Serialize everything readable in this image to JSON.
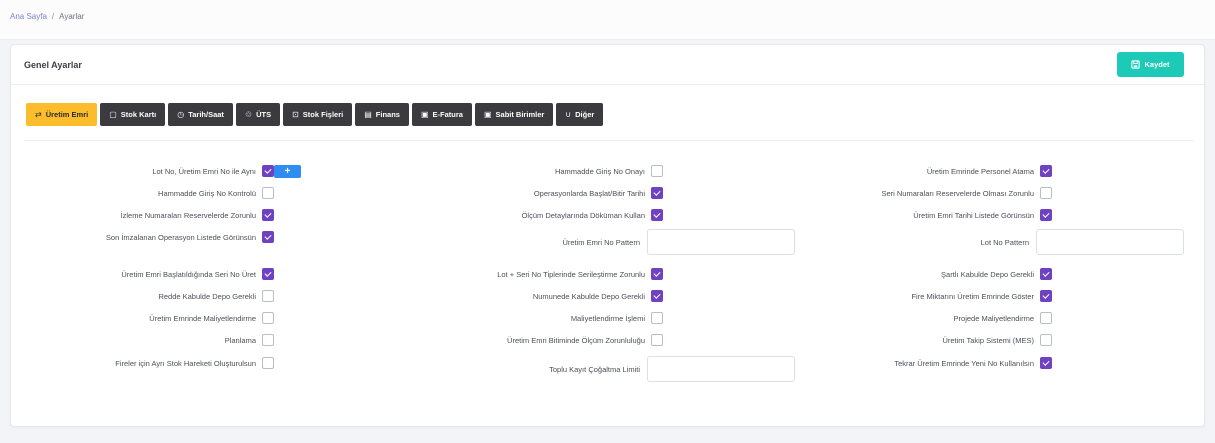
{
  "breadcrumb": {
    "home": "Ana Sayfa",
    "separator": "/",
    "current": "Ayarlar"
  },
  "card": {
    "title": "Genel Ayarlar",
    "save_label": "Kaydet"
  },
  "tabs": [
    {
      "label": "Üretim Emri",
      "icon": "⇄"
    },
    {
      "label": "Stok Kartı",
      "icon": "▢"
    },
    {
      "label": "Tarih/Saat",
      "icon": "◷"
    },
    {
      "label": "ÜTS",
      "icon": "♲"
    },
    {
      "label": "Stok Fişleri",
      "icon": "⊡"
    },
    {
      "label": "Finans",
      "icon": "▤"
    },
    {
      "label": "E-Fatura",
      "icon": "▣"
    },
    {
      "label": "Sabit Birimler",
      "icon": "▣"
    },
    {
      "label": "Diğer",
      "icon": "∪"
    }
  ],
  "plus_label": "+",
  "col1": [
    {
      "label": "Lot No, Üretim Emri No ile Aynı",
      "checked": true
    },
    {
      "label": "Hammadde Giriş No Kontrolü",
      "checked": false
    },
    {
      "label": "İzleme Numaraları Reservelerde Zorunlu",
      "checked": true
    },
    {
      "label": "Son İmzalanan Operasyon Listede Görünsün",
      "checked": true
    },
    {
      "label": "Üretim Emri Başlatıldığında Seri No Üret",
      "checked": true
    },
    {
      "label": "Redde Kabulde Depo Gerekli",
      "checked": false
    },
    {
      "label": "Üretim Emrinde Maliyetlendirme",
      "checked": false
    },
    {
      "label": "Planlama",
      "checked": false
    },
    {
      "label": "Fireler için Ayrı Stok Hareketi Oluşturulsun",
      "checked": false
    }
  ],
  "col2": [
    {
      "label": "Hammadde Giriş No Onayı",
      "checked": false
    },
    {
      "label": "Operasyonlarda Başlat/Bitir Tarihi",
      "checked": true
    },
    {
      "label": "Ölçüm Detaylarında Döküman Kullan",
      "checked": true
    },
    {
      "label": "Üretim Emri No Pattern",
      "input": true,
      "value": ""
    },
    {
      "label": "Lot + Seri No Tiplerinde Serileştirme Zorunlu",
      "checked": true
    },
    {
      "label": "Numunede Kabulde Depo Gerekli",
      "checked": true
    },
    {
      "label": "Maliyetlendirme İşlemi",
      "checked": false
    },
    {
      "label": "Üretim Emri Bitiminde Ölçüm Zorunluluğu",
      "checked": false
    },
    {
      "label": "Toplu Kayıt Çoğaltma Limiti",
      "input": true,
      "value": ""
    }
  ],
  "col3": [
    {
      "label": "Üretim Emrinde Personel Atama",
      "checked": true
    },
    {
      "label": "Seri Numaraları Reservelerde Olması Zorunlu",
      "checked": false
    },
    {
      "label": "Üretim Emri Tarihi Listede Görünsün",
      "checked": true
    },
    {
      "label": "Lot No Pattern",
      "input": true,
      "value": ""
    },
    {
      "label": "Şartlı Kabulde Depo Gerekli",
      "checked": true
    },
    {
      "label": "Fire Miktarını Üretim Emrinde Göster",
      "checked": true
    },
    {
      "label": "Projede Maliyetlendirme",
      "checked": false
    },
    {
      "label": "Üretim Takip Sistemi (MES)",
      "checked": false
    },
    {
      "label": "Tekrar Üretim Emrinde Yeni No Kullanılsın",
      "checked": true
    }
  ],
  "colors": {
    "accent": "#1dc9b7",
    "active_tab": "#fbbd2b",
    "checkbox": "#6f42c1",
    "plus": "#2f8cf0"
  }
}
